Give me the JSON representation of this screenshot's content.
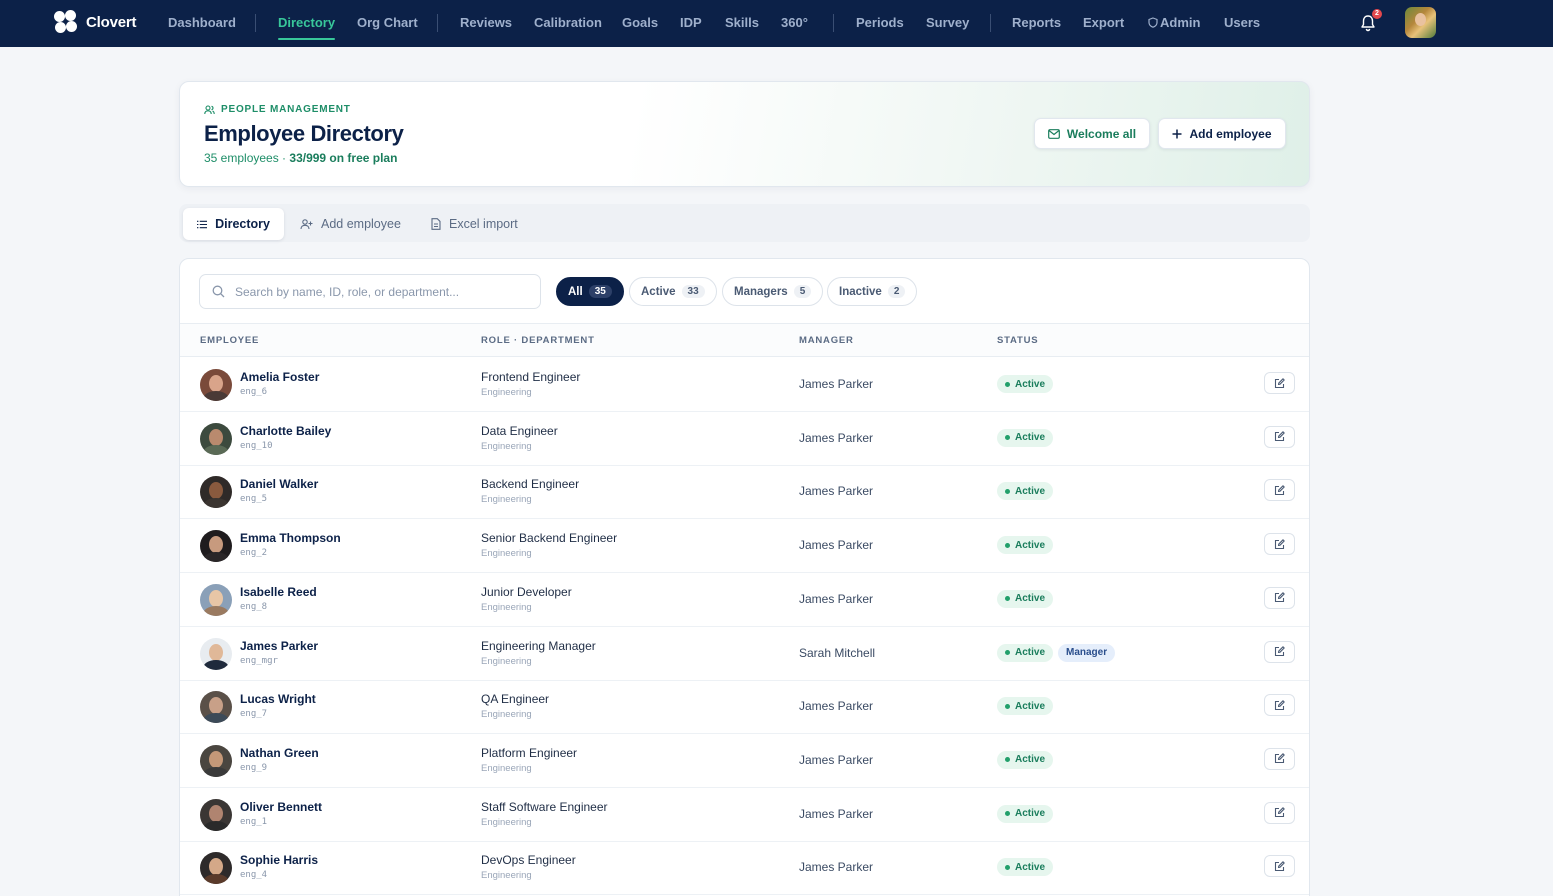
{
  "app": {
    "name": "Clovert",
    "nav": [
      {
        "label": "Dashboard",
        "active": false
      },
      {
        "label": "Directory",
        "active": true
      },
      {
        "label": "Org Chart",
        "active": false
      },
      {
        "label": "Reviews",
        "active": false
      },
      {
        "label": "Calibration",
        "active": false
      },
      {
        "label": "Goals",
        "active": false
      },
      {
        "label": "IDP",
        "active": false
      },
      {
        "label": "Skills",
        "active": false
      },
      {
        "label": "360°",
        "active": false
      },
      {
        "label": "Periods",
        "active": false
      },
      {
        "label": "Survey",
        "active": false
      },
      {
        "label": "Reports",
        "active": false
      },
      {
        "label": "Export",
        "active": false
      },
      {
        "label": "Admin",
        "active": false
      },
      {
        "label": "Users",
        "active": false
      }
    ],
    "notifications_count": "2"
  },
  "header": {
    "eyebrow": "PEOPLE MANAGEMENT",
    "title": "Employee Directory",
    "count_text": "35 employees · ",
    "plan_text": "33/999 on free plan",
    "welcome_label": "Welcome all",
    "add_label": "Add employee"
  },
  "tabs": [
    {
      "label": "Directory",
      "icon": "list-icon",
      "active": true
    },
    {
      "label": "Add employee",
      "icon": "user-plus-icon",
      "active": false
    },
    {
      "label": "Excel import",
      "icon": "file-icon",
      "active": false
    }
  ],
  "search": {
    "placeholder": "Search by name, ID, role, or department..."
  },
  "filters": [
    {
      "label": "All",
      "count": "35",
      "active": true
    },
    {
      "label": "Active",
      "count": "33",
      "active": false
    },
    {
      "label": "Managers",
      "count": "5",
      "active": false
    },
    {
      "label": "Inactive",
      "count": "2",
      "active": false
    }
  ],
  "columns": {
    "employee": "EMPLOYEE",
    "role": "ROLE · DEPARTMENT",
    "manager": "MANAGER",
    "status": "STATUS"
  },
  "rows": [
    {
      "name": "Amelia Foster",
      "id": "eng_6",
      "role": "Frontend Engineer",
      "dept": "Engineering",
      "manager": "James Parker",
      "status": "Active",
      "badge": ""
    },
    {
      "name": "Charlotte Bailey",
      "id": "eng_10",
      "role": "Data Engineer",
      "dept": "Engineering",
      "manager": "James Parker",
      "status": "Active",
      "badge": ""
    },
    {
      "name": "Daniel Walker",
      "id": "eng_5",
      "role": "Backend Engineer",
      "dept": "Engineering",
      "manager": "James Parker",
      "status": "Active",
      "badge": ""
    },
    {
      "name": "Emma Thompson",
      "id": "eng_2",
      "role": "Senior Backend Engineer",
      "dept": "Engineering",
      "manager": "James Parker",
      "status": "Active",
      "badge": ""
    },
    {
      "name": "Isabelle Reed",
      "id": "eng_8",
      "role": "Junior Developer",
      "dept": "Engineering",
      "manager": "James Parker",
      "status": "Active",
      "badge": ""
    },
    {
      "name": "James Parker",
      "id": "eng_mgr",
      "role": "Engineering Manager",
      "dept": "Engineering",
      "manager": "Sarah Mitchell",
      "status": "Active",
      "badge": "Manager"
    },
    {
      "name": "Lucas Wright",
      "id": "eng_7",
      "role": "QA Engineer",
      "dept": "Engineering",
      "manager": "James Parker",
      "status": "Active",
      "badge": ""
    },
    {
      "name": "Nathan Green",
      "id": "eng_9",
      "role": "Platform Engineer",
      "dept": "Engineering",
      "manager": "James Parker",
      "status": "Active",
      "badge": ""
    },
    {
      "name": "Oliver Bennett",
      "id": "eng_1",
      "role": "Staff Software Engineer",
      "dept": "Engineering",
      "manager": "James Parker",
      "status": "Active",
      "badge": ""
    },
    {
      "name": "Sophie Harris",
      "id": "eng_4",
      "role": "DevOps Engineer",
      "dept": "Engineering",
      "manager": "James Parker",
      "status": "Active",
      "badge": ""
    }
  ],
  "colors": {
    "nav_bg": "#0c2148",
    "accent": "#1a7d5c",
    "active_nav": "#38c79a"
  }
}
